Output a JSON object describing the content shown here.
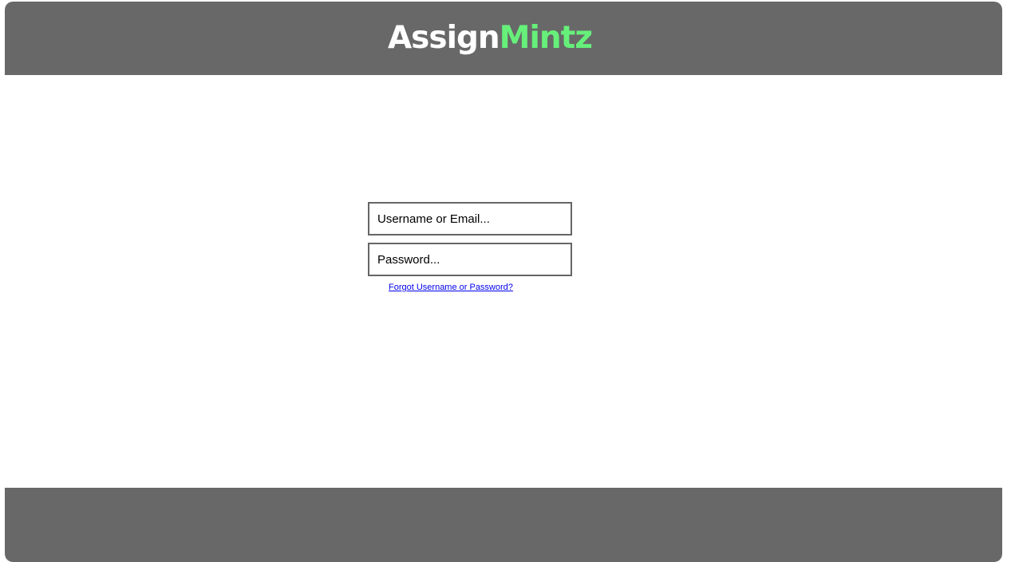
{
  "app": {
    "logo": {
      "part1": "Assign",
      "part2": "Mintz"
    }
  },
  "login": {
    "username_placeholder": "Username or Email...",
    "username_value": "",
    "password_placeholder": "Password...",
    "password_value": "",
    "forgot_link": "Forgot Username or Password?"
  },
  "colors": {
    "header_bg": "#686868",
    "footer_bg": "#686868",
    "logo_accent": "#66f07a",
    "link": "#0000ee"
  }
}
